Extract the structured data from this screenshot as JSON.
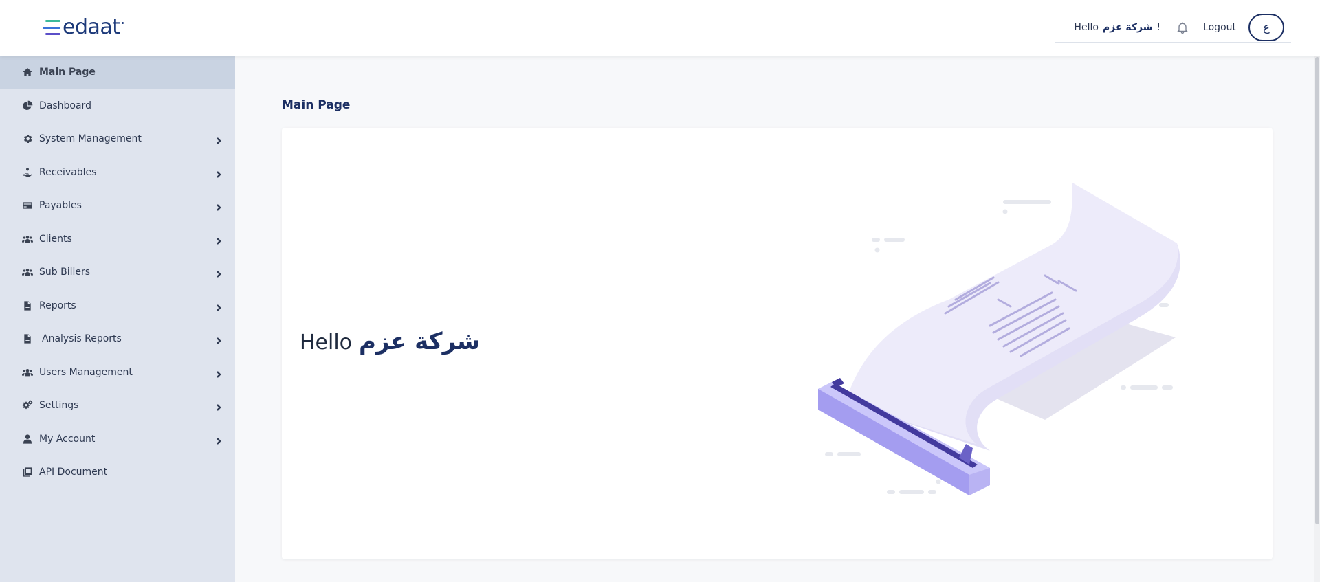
{
  "app": {
    "brand": "edaat",
    "brand_colors": {
      "primary": "#1c2f63",
      "accent_green": "#3bb99a",
      "accent_blue": "#3a72d8"
    }
  },
  "header": {
    "greeting_prefix": "Hello",
    "greeting_name": "شركة عزم",
    "greeting_suffix": "!",
    "notification_icon": "bell-icon",
    "logout_label": "Logout",
    "language_toggle_label": "ع"
  },
  "sidebar": {
    "items": [
      {
        "label": "Main Page",
        "icon": "home-icon",
        "active": true,
        "has_submenu": false
      },
      {
        "label": "Dashboard",
        "icon": "pie-chart-icon",
        "active": false,
        "has_submenu": false
      },
      {
        "label": "System Management",
        "icon": "gear-icon",
        "active": false,
        "has_submenu": true
      },
      {
        "label": "Receivables",
        "icon": "hand-coin-icon",
        "active": false,
        "has_submenu": true
      },
      {
        "label": "Payables",
        "icon": "credit-card-icon",
        "active": false,
        "has_submenu": true
      },
      {
        "label": "Clients",
        "icon": "users-icon",
        "active": false,
        "has_submenu": true
      },
      {
        "label": "Sub Billers",
        "icon": "users-icon",
        "active": false,
        "has_submenu": true
      },
      {
        "label": "Reports",
        "icon": "file-icon",
        "active": false,
        "has_submenu": true
      },
      {
        "label": "Analysis Reports",
        "icon": "file-icon",
        "active": false,
        "has_submenu": true
      },
      {
        "label": "Users Management",
        "icon": "users-icon",
        "active": false,
        "has_submenu": true
      },
      {
        "label": "Settings",
        "icon": "gears-icon",
        "active": false,
        "has_submenu": true
      },
      {
        "label": "My Account",
        "icon": "user-icon",
        "active": false,
        "has_submenu": true
      },
      {
        "label": "API Document",
        "icon": "copy-icon",
        "active": false,
        "has_submenu": false
      }
    ]
  },
  "main": {
    "page_title": "Main Page",
    "hello_text": "Hello",
    "hello_name": "شركة عزم",
    "illustration": "receipt-printer-illustration"
  }
}
